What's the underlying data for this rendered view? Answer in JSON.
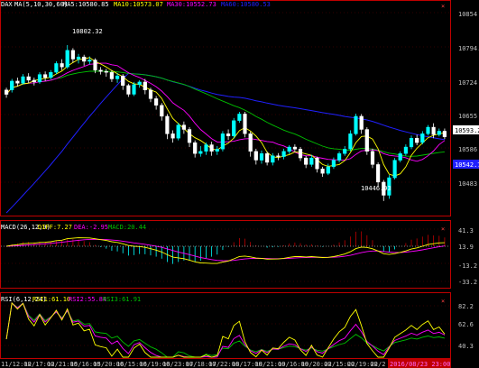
{
  "colors": {
    "background": "#000000",
    "frame": "#c00000",
    "up_candle": "#00ffff",
    "down_candle": "#ffffff",
    "ma5": "#ffffff",
    "ma10": "#ffff00",
    "ma30": "#ff00ff",
    "ma60": "#00c000",
    "ma_long": "#2020ff",
    "dif": "#ffff00",
    "dea": "#ff00ff",
    "macd_pos": "#c00000",
    "macd_neg": "#00ffff",
    "rsi6": "#ffff00",
    "rsi12": "#ff00ff",
    "rsi24": "#00c000",
    "date_tag_bg": "#c00000",
    "date_tag_text": "#ff66ff"
  },
  "panels": {
    "price": {
      "title": "DAX",
      "indicator": "MA(5,10,30,60)",
      "ma5_label": "MA5:10580.85",
      "ma10_label": "MA10:10573.07",
      "ma30_label": "MA30:10552.73",
      "ma60_label": "MA60:10580.53",
      "high_annotation": "10802.32",
      "low_annotation": "10446.93",
      "current_price_tag": "10593.2",
      "ma_price_tag": "10542.7",
      "y_ticks": [
        "10854",
        "10794.2",
        "10724",
        "10655",
        "10586",
        "10483"
      ],
      "close_icon": "×"
    },
    "macd": {
      "title": "MACD(26,12,9)",
      "dif_label": "DIFF:7.27",
      "dea_label": "DEA:-2.95",
      "macd_label": "MACD:20.44",
      "y_ticks": [
        "41.3",
        "13.9",
        "-13.2",
        "-33.2"
      ],
      "close_icon": "×"
    },
    "rsi": {
      "title": "RSI(6,12,24)",
      "rsi6_label": "RSI1:61.10",
      "rsi12_label": "RSI2:55.84",
      "rsi24_label": "RSI3:61.91",
      "y_ticks": [
        "82.2",
        "62.6",
        "40.3"
      ],
      "close_icon": "×"
    }
  },
  "x_labels": [
    "11/12:00",
    "12/17:00",
    "12/21:00",
    "15/16:00",
    "15/20:00",
    "16/15:00",
    "16/19:00",
    "16/23:00",
    "17/18:00",
    "17/22:00",
    "18/17:00",
    "18/21:00",
    "19/16:00",
    "19/20:00",
    "22/15:00",
    "22/19:00",
    "22/2"
  ],
  "date_tag": "2016/08/23 23:00",
  "chart_data": {
    "type": "candlestick",
    "title": "DAX",
    "x_labels": [
      "11/12:00",
      "12/17:00",
      "12/21:00",
      "15/16:00",
      "15/20:00",
      "16/15:00",
      "16/19:00",
      "16/23:00",
      "17/18:00",
      "17/22:00",
      "18/17:00",
      "18/21:00",
      "19/16:00",
      "19/20:00",
      "22/15:00",
      "22/19:00",
      "22/2"
    ],
    "ylim": [
      10420,
      10880
    ],
    "candles": [
      [
        10700,
        10690,
        10705,
        10682
      ],
      [
        10700,
        10720,
        10725,
        10694
      ],
      [
        10720,
        10715,
        10728,
        10708
      ],
      [
        10715,
        10730,
        10736,
        10712
      ],
      [
        10730,
        10722,
        10738,
        10716
      ],
      [
        10722,
        10718,
        10728,
        10710
      ],
      [
        10718,
        10735,
        10740,
        10714
      ],
      [
        10735,
        10728,
        10742,
        10720
      ],
      [
        10728,
        10740,
        10745,
        10724
      ],
      [
        10740,
        10760,
        10765,
        10736
      ],
      [
        10760,
        10752,
        10770,
        10745
      ],
      [
        10752,
        10790,
        10802,
        10748
      ],
      [
        10790,
        10770,
        10795,
        10762
      ],
      [
        10770,
        10775,
        10782,
        10760
      ],
      [
        10775,
        10765,
        10780,
        10755
      ],
      [
        10765,
        10768,
        10776,
        10758
      ],
      [
        10768,
        10745,
        10772,
        10738
      ],
      [
        10745,
        10742,
        10752,
        10735
      ],
      [
        10742,
        10740,
        10748,
        10730
      ],
      [
        10740,
        10725,
        10745,
        10718
      ],
      [
        10725,
        10732,
        10738,
        10716
      ],
      [
        10732,
        10710,
        10736,
        10700
      ],
      [
        10710,
        10690,
        10714,
        10684
      ],
      [
        10690,
        10712,
        10718,
        10686
      ],
      [
        10712,
        10718,
        10722,
        10705
      ],
      [
        10718,
        10700,
        10725,
        10690
      ],
      [
        10700,
        10680,
        10705,
        10672
      ],
      [
        10680,
        10665,
        10686,
        10655
      ],
      [
        10665,
        10640,
        10670,
        10630
      ],
      [
        10640,
        10600,
        10645,
        10588
      ],
      [
        10600,
        10590,
        10608,
        10580
      ],
      [
        10590,
        10620,
        10625,
        10585
      ],
      [
        10620,
        10610,
        10628,
        10600
      ],
      [
        10610,
        10580,
        10615,
        10570
      ],
      [
        10580,
        10555,
        10585,
        10546
      ],
      [
        10555,
        10560,
        10572,
        10548
      ],
      [
        10560,
        10575,
        10580,
        10552
      ],
      [
        10575,
        10560,
        10582,
        10550
      ],
      [
        10560,
        10565,
        10572,
        10552
      ],
      [
        10565,
        10600,
        10606,
        10560
      ],
      [
        10600,
        10595,
        10610,
        10586
      ],
      [
        10595,
        10630,
        10636,
        10590
      ],
      [
        10630,
        10645,
        10650,
        10625
      ],
      [
        10645,
        10600,
        10650,
        10592
      ],
      [
        10600,
        10560,
        10605,
        10548
      ],
      [
        10560,
        10540,
        10566,
        10530
      ],
      [
        10540,
        10555,
        10562,
        10532
      ],
      [
        10555,
        10535,
        10560,
        10528
      ],
      [
        10535,
        10550,
        10556,
        10528
      ],
      [
        10550,
        10548,
        10556,
        10540
      ],
      [
        10548,
        10560,
        10566,
        10542
      ],
      [
        10560,
        10570,
        10574,
        10554
      ],
      [
        10570,
        10565,
        10576,
        10558
      ],
      [
        10565,
        10545,
        10570,
        10538
      ],
      [
        10545,
        10530,
        10550,
        10522
      ],
      [
        10530,
        10545,
        10552,
        10525
      ],
      [
        10545,
        10520,
        10548,
        10512
      ],
      [
        10520,
        10510,
        10525,
        10502
      ],
      [
        10510,
        10525,
        10532,
        10506
      ],
      [
        10525,
        10540,
        10546,
        10520
      ],
      [
        10540,
        10555,
        10560,
        10535
      ],
      [
        10555,
        10565,
        10572,
        10550
      ],
      [
        10565,
        10600,
        10608,
        10560
      ],
      [
        10600,
        10640,
        10646,
        10596
      ],
      [
        10640,
        10610,
        10645,
        10600
      ],
      [
        10610,
        10560,
        10615,
        10552
      ],
      [
        10560,
        10530,
        10566,
        10522
      ],
      [
        10530,
        10490,
        10535,
        10480
      ],
      [
        10490,
        10460,
        10495,
        10447
      ],
      [
        10460,
        10500,
        10506,
        10452
      ],
      [
        10500,
        10540,
        10545,
        10496
      ],
      [
        10540,
        10555,
        10560,
        10535
      ],
      [
        10555,
        10570,
        10576,
        10550
      ],
      [
        10570,
        10590,
        10596,
        10565
      ],
      [
        10590,
        10580,
        10598,
        10574
      ],
      [
        10580,
        10600,
        10606,
        10576
      ],
      [
        10600,
        10615,
        10620,
        10596
      ],
      [
        10615,
        10598,
        10624,
        10590
      ],
      [
        10598,
        10606,
        10612,
        10594
      ],
      [
        10606,
        10593,
        10612,
        10588
      ]
    ],
    "macd": {
      "ylim": [
        -40,
        50
      ],
      "dif_label": "DIFF:7.27",
      "dea_label": "DEA:-2.95",
      "macd_label": "MACD:20.44"
    },
    "rsi": {
      "ylim": [
        30,
        90
      ],
      "rsi6_label": "RSI1:61.10",
      "rsi12_label": "RSI2:55.84",
      "rsi24_label": "RSI3:61.91"
    }
  }
}
